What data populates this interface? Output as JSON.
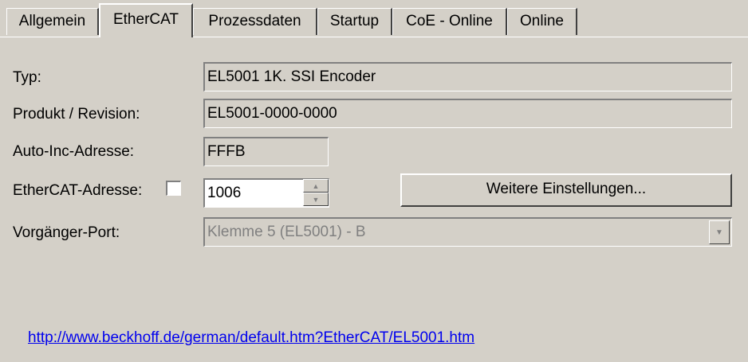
{
  "tabs": [
    {
      "label": "Allgemein"
    },
    {
      "label": "EtherCAT",
      "active": true
    },
    {
      "label": "Prozessdaten"
    },
    {
      "label": "Startup"
    },
    {
      "label": "CoE - Online"
    },
    {
      "label": "Online"
    }
  ],
  "form": {
    "typ_label": "Typ:",
    "typ_value": "EL5001 1K. SSI Encoder",
    "produkt_label": "Produkt / Revision:",
    "produkt_value": "EL5001-0000-0000",
    "autoinc_label": "Auto-Inc-Adresse:",
    "autoinc_value": "FFFB",
    "ethercat_label": "EtherCAT-Adresse:",
    "ethercat_checked": false,
    "ethercat_value": "1006",
    "weitere_button": "Weitere Einstellungen...",
    "vorgaenger_label": "Vorgänger-Port:",
    "vorgaenger_value": "Klemme 5 (EL5001) - B"
  },
  "link": {
    "text": "http://www.beckhoff.de/german/default.htm?EtherCAT/EL5001.htm"
  },
  "icons": {
    "spin_up": "triangle-up",
    "spin_down": "triangle-down",
    "combo_arrow": "triangle-down"
  }
}
